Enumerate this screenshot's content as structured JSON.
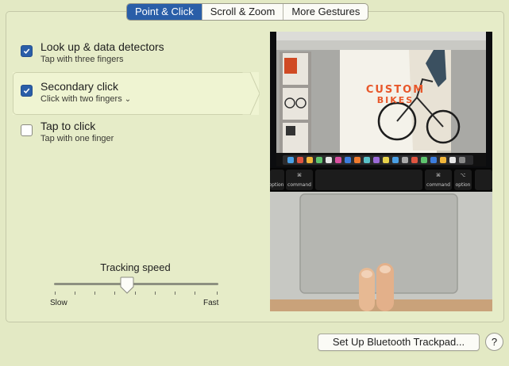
{
  "tabs": [
    {
      "label": "Point & Click",
      "active": true
    },
    {
      "label": "Scroll & Zoom",
      "active": false
    },
    {
      "label": "More Gestures",
      "active": false
    }
  ],
  "options": [
    {
      "title": "Look up & data detectors",
      "subtitle": "Tap with three fingers",
      "checked": true
    },
    {
      "title": "Secondary click",
      "subtitle": "Click with two fingers",
      "checked": true,
      "has_menu": true
    },
    {
      "title": "Tap to click",
      "subtitle": "Tap with one finger",
      "checked": false
    }
  ],
  "tracking": {
    "label": "Tracking speed",
    "min_label": "Slow",
    "max_label": "Fast",
    "value_fraction": 0.45
  },
  "preview": {
    "poster_title_line1": "CUSTOM",
    "poster_title_line2": "BIKES",
    "key_labels": [
      "⌘",
      "command",
      "⌘",
      "command",
      "⌥",
      "option",
      "option"
    ]
  },
  "bottom": {
    "setup_button": "Set Up Bluetooth Trackpad...",
    "help": "?"
  },
  "colors": {
    "accent": "#2a5ea8",
    "background": "#e3e9c4",
    "poster_title": "#e8572a"
  }
}
